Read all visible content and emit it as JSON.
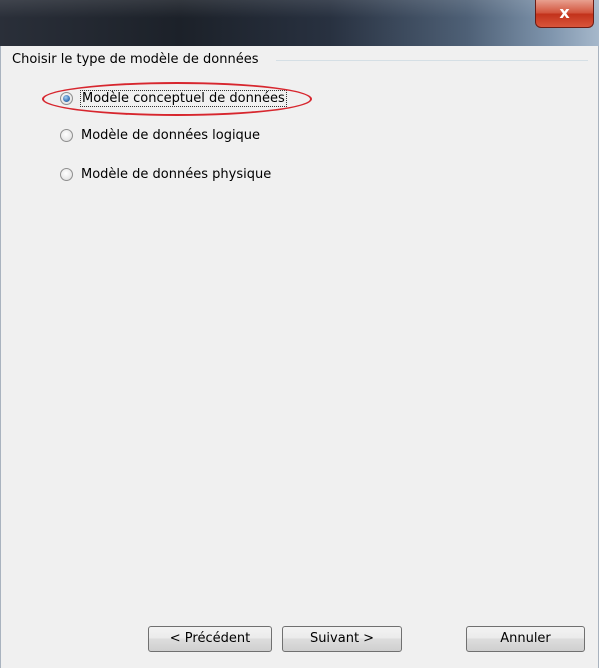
{
  "window": {
    "close_glyph": "x"
  },
  "group": {
    "title": "Choisir le type de modèle de données"
  },
  "options": [
    {
      "label": "Modèle conceptuel de données",
      "checked": true
    },
    {
      "label": "Modèle de données logique",
      "checked": false
    },
    {
      "label": "Modèle de données physique",
      "checked": false
    }
  ],
  "buttons": {
    "previous_label": "< Précédent",
    "next_label": "Suivant >",
    "cancel_label": "Annuler"
  },
  "icons": {
    "close": "close-icon"
  },
  "colors": {
    "annotation": "#d7262e",
    "close_button": "#c2321b",
    "dialog_background": "#f0f0f0"
  }
}
